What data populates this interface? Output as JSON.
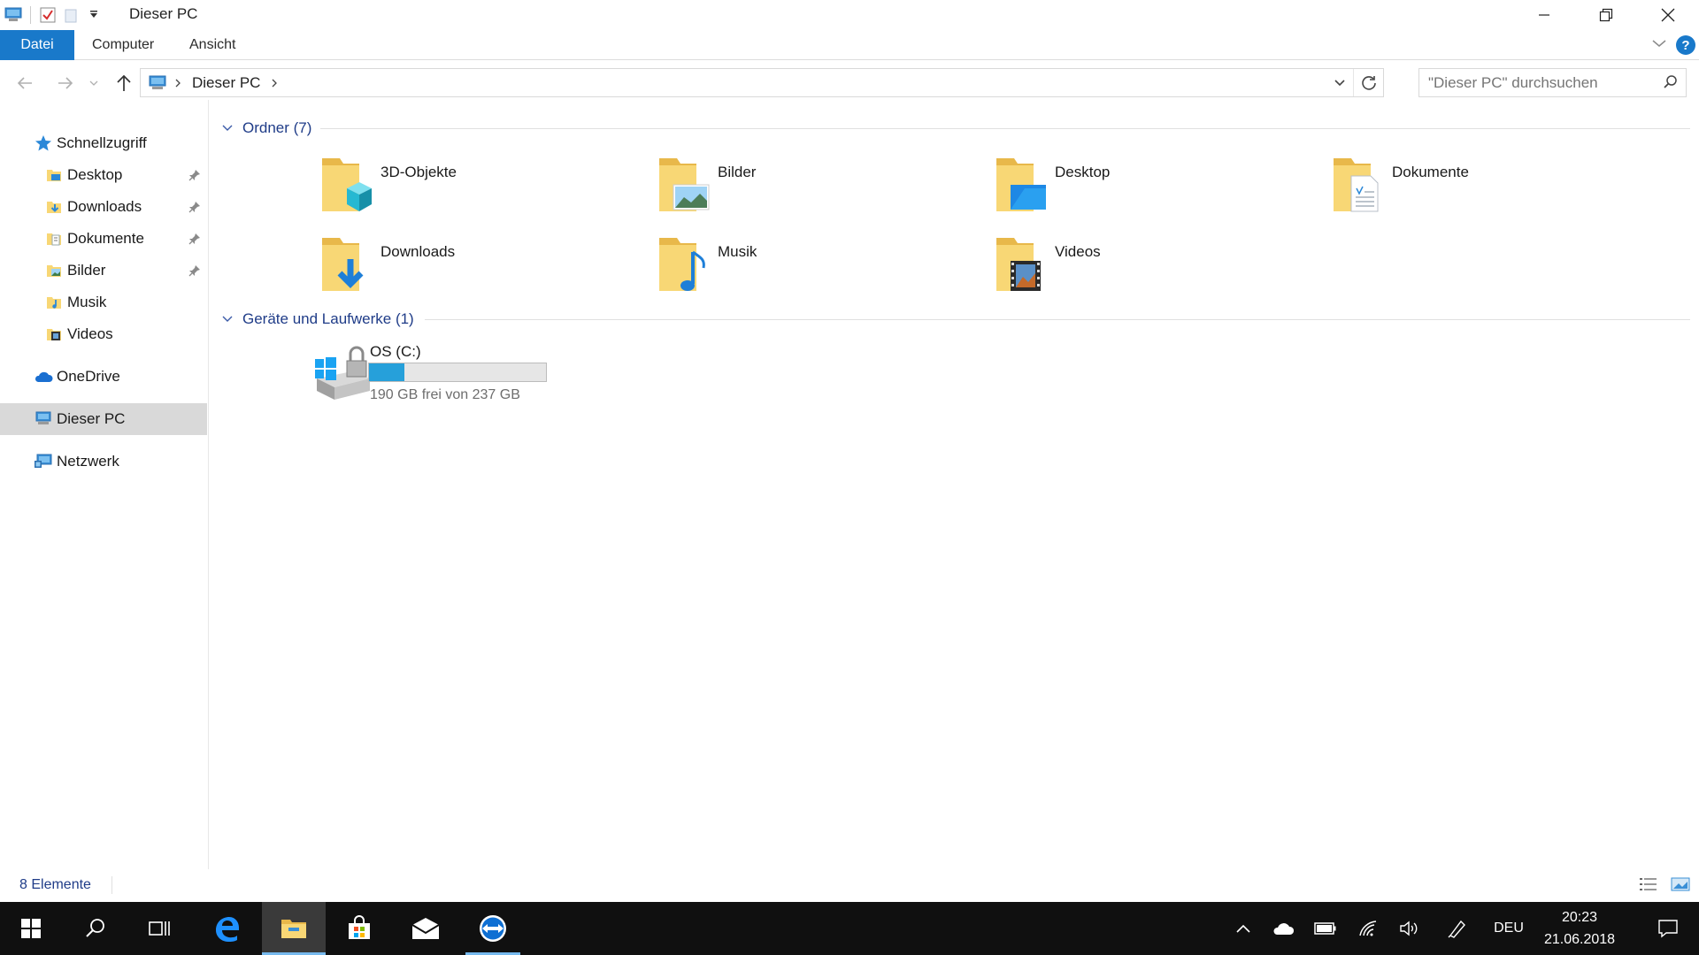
{
  "window": {
    "title": "Dieser PC",
    "controls": [
      "minimize",
      "restore",
      "close"
    ]
  },
  "ribbon": {
    "tabs": [
      {
        "label": "Datei",
        "active": true
      },
      {
        "label": "Computer",
        "active": false
      },
      {
        "label": "Ansicht",
        "active": false
      }
    ],
    "help": "?"
  },
  "address": {
    "breadcrumb": "Dieser PC",
    "search_placeholder": "\"Dieser PC\" durchsuchen"
  },
  "sidebar": {
    "items": [
      {
        "label": "Schnellzugriff",
        "icon": "star-icon",
        "pinned": false
      },
      {
        "label": "Desktop",
        "icon": "folder-desktop-icon",
        "pinned": true
      },
      {
        "label": "Downloads",
        "icon": "folder-downloads-icon",
        "pinned": true
      },
      {
        "label": "Dokumente",
        "icon": "folder-documents-icon",
        "pinned": true
      },
      {
        "label": "Bilder",
        "icon": "folder-pictures-icon",
        "pinned": true
      },
      {
        "label": "Musik",
        "icon": "folder-music-icon",
        "pinned": false
      },
      {
        "label": "Videos",
        "icon": "folder-videos-icon",
        "pinned": false
      },
      {
        "label": "OneDrive",
        "icon": "cloud-icon",
        "pinned": false
      },
      {
        "label": "Dieser PC",
        "icon": "computer-icon",
        "selected": true
      },
      {
        "label": "Netzwerk",
        "icon": "network-icon",
        "pinned": false
      }
    ]
  },
  "groups": {
    "folders": {
      "title": "Ordner (7)",
      "items": [
        "3D-Objekte",
        "Bilder",
        "Desktop",
        "Dokumente",
        "Downloads",
        "Musik",
        "Videos"
      ]
    },
    "drives": {
      "title": "Geräte und Laufwerke (1)",
      "items": [
        {
          "label": "OS (C:)",
          "free_text": "190 GB frei von 237 GB",
          "used_fraction": 0.198
        }
      ]
    }
  },
  "status": {
    "count": "8 Elemente"
  },
  "taskbar": {
    "apps": [
      "start",
      "search",
      "task-view",
      "edge",
      "file-explorer",
      "store",
      "mail",
      "teamviewer"
    ],
    "language": "DEU",
    "time": "20:23",
    "date": "21.06.2018"
  },
  "colors": {
    "accent": "#1979ca",
    "drive_bar": "#26a0da",
    "folder_yellow": "#f8d775",
    "taskbar": "#101010"
  }
}
